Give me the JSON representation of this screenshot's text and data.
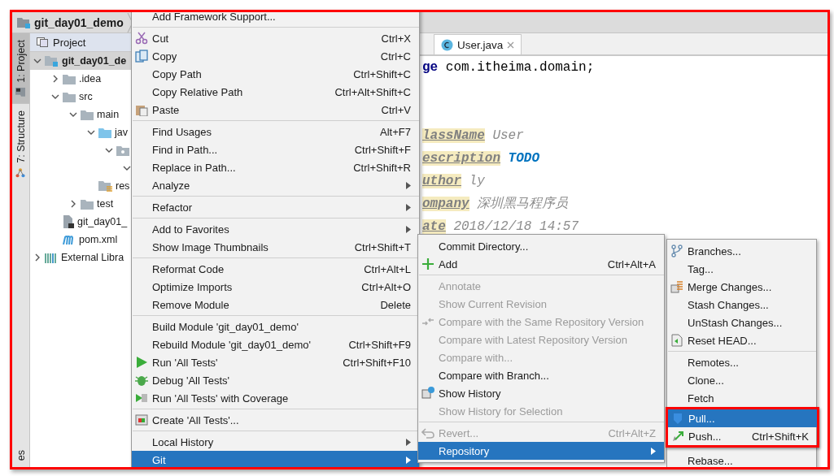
{
  "breadcrumb": {
    "label": "git_day01_demo"
  },
  "tool_strip": {
    "top": [
      {
        "label": "1: Project",
        "selected": true
      },
      {
        "label": "7: Structure",
        "selected": false
      }
    ],
    "bottom": [
      {
        "label": "es",
        "selected": false
      }
    ]
  },
  "project_panel": {
    "title": "Project",
    "tree": [
      {
        "label": "git_day01_de",
        "kind": "module",
        "expanded": true,
        "selected": true,
        "children": [
          {
            "label": ".idea",
            "kind": "folder",
            "expanded": false,
            "selected": false
          },
          {
            "label": "src",
            "kind": "folder",
            "expanded": true,
            "selected": false,
            "children": [
              {
                "label": "main",
                "kind": "folder",
                "expanded": true,
                "selected": false,
                "children": [
                  {
                    "label": "jav",
                    "kind": "source-folder",
                    "expanded": true,
                    "selected": false,
                    "children": [
                      {
                        "kind": "package",
                        "expanded": true,
                        "selected": false,
                        "children": [
                          {
                            "expanded": true,
                            "selected": false
                          }
                        ]
                      }
                    ]
                  },
                  {
                    "label": "res",
                    "kind": "resource-folder",
                    "selected": false
                  }
                ]
              },
              {
                "label": "test",
                "kind": "folder",
                "expanded": false,
                "selected": false
              }
            ]
          },
          {
            "label": "git_day01_",
            "kind": "module-file",
            "selected": false
          },
          {
            "label": "pom.xml",
            "kind": "maven-file",
            "selected": false
          }
        ]
      },
      {
        "label": "External Libra",
        "kind": "library",
        "expanded": false,
        "selected": false
      }
    ]
  },
  "editor": {
    "tabs": [
      {
        "label": "User.java",
        "selected": true
      }
    ],
    "lines": [
      {
        "kind": "code",
        "segments": [
          {
            "text": "ge",
            "kind": "keyword"
          },
          {
            "text": " com.itheima.domain;",
            "kind": "plain"
          }
        ]
      },
      {
        "kind": "blank"
      },
      {
        "kind": "blank"
      },
      {
        "kind": "code",
        "segments": [
          {
            "text": "lassName",
            "kind": "tag"
          },
          {
            "text": " User",
            "kind": "value"
          }
        ]
      },
      {
        "kind": "code",
        "segments": [
          {
            "text": "escription",
            "kind": "tag"
          },
          {
            "text": " TODO",
            "kind": "todo"
          }
        ]
      },
      {
        "kind": "code",
        "segments": [
          {
            "text": "uthor",
            "kind": "tag"
          },
          {
            "text": " ly",
            "kind": "value"
          }
        ]
      },
      {
        "kind": "code",
        "segments": [
          {
            "text": "ompany",
            "kind": "tag"
          },
          {
            "text": " 深圳黑马程序员",
            "kind": "value"
          }
        ]
      },
      {
        "kind": "code",
        "segments": [
          {
            "text": "ate",
            "kind": "tag"
          },
          {
            "text": " 2018/12/18 14:57",
            "kind": "value"
          }
        ]
      }
    ]
  },
  "menus": [
    {
      "items": [
        {
          "kind": "item",
          "label": "Add Framework Support...",
          "submenu": false,
          "disabled": false,
          "selected": false
        },
        {
          "kind": "separator"
        },
        {
          "kind": "item",
          "label": "Cut",
          "shortcut": "Ctrl+X",
          "submenu": false,
          "disabled": false,
          "selected": false
        },
        {
          "kind": "item",
          "label": "Copy",
          "shortcut": "Ctrl+C",
          "submenu": false,
          "disabled": false,
          "selected": false
        },
        {
          "kind": "item",
          "label": "Copy Path",
          "shortcut": "Ctrl+Shift+C",
          "submenu": false,
          "disabled": false,
          "selected": false
        },
        {
          "kind": "item",
          "label": "Copy Relative Path",
          "shortcut": "Ctrl+Alt+Shift+C",
          "submenu": false,
          "disabled": false,
          "selected": false
        },
        {
          "kind": "item",
          "label": "Paste",
          "shortcut": "Ctrl+V",
          "submenu": false,
          "disabled": false,
          "selected": false
        },
        {
          "kind": "separator"
        },
        {
          "kind": "item",
          "label": "Find Usages",
          "shortcut": "Alt+F7",
          "submenu": false,
          "disabled": false,
          "selected": false
        },
        {
          "kind": "item",
          "label": "Find in Path...",
          "shortcut": "Ctrl+Shift+F",
          "submenu": false,
          "disabled": false,
          "selected": false
        },
        {
          "kind": "item",
          "label": "Replace in Path...",
          "shortcut": "Ctrl+Shift+R",
          "submenu": false,
          "disabled": false,
          "selected": false
        },
        {
          "kind": "item",
          "label": "Analyze",
          "submenu": true,
          "disabled": false,
          "selected": false
        },
        {
          "kind": "separator"
        },
        {
          "kind": "item",
          "label": "Refactor",
          "submenu": true,
          "disabled": false,
          "selected": false
        },
        {
          "kind": "separator"
        },
        {
          "kind": "item",
          "label": "Add to Favorites",
          "submenu": true,
          "disabled": false,
          "selected": false
        },
        {
          "kind": "item",
          "label": "Show Image Thumbnails",
          "shortcut": "Ctrl+Shift+T",
          "submenu": false,
          "disabled": false,
          "selected": false
        },
        {
          "kind": "separator"
        },
        {
          "kind": "item",
          "label": "Reformat Code",
          "shortcut": "Ctrl+Alt+L",
          "submenu": false,
          "disabled": false,
          "selected": false
        },
        {
          "kind": "item",
          "label": "Optimize Imports",
          "shortcut": "Ctrl+Alt+O",
          "submenu": false,
          "disabled": false,
          "selected": false
        },
        {
          "kind": "item",
          "label": "Remove Module",
          "shortcut": "Delete",
          "submenu": false,
          "disabled": false,
          "selected": false
        },
        {
          "kind": "separator"
        },
        {
          "kind": "item",
          "label": "Build Module 'git_day01_demo'",
          "submenu": false,
          "disabled": false,
          "selected": false
        },
        {
          "kind": "item",
          "label": "Rebuild Module 'git_day01_demo'",
          "shortcut": "Ctrl+Shift+F9",
          "submenu": false,
          "disabled": false,
          "selected": false
        },
        {
          "kind": "item",
          "label": "Run 'All Tests'",
          "shortcut": "Ctrl+Shift+F10",
          "submenu": false,
          "disabled": false,
          "selected": false
        },
        {
          "kind": "item",
          "label": "Debug 'All Tests'",
          "submenu": false,
          "disabled": false,
          "selected": false
        },
        {
          "kind": "item",
          "label": "Run 'All Tests' with Coverage",
          "submenu": false,
          "disabled": false,
          "selected": false
        },
        {
          "kind": "separator"
        },
        {
          "kind": "item",
          "label": "Create 'All Tests'...",
          "submenu": false,
          "disabled": false,
          "selected": false
        },
        {
          "kind": "separator"
        },
        {
          "kind": "item",
          "label": "Local History",
          "submenu": true,
          "disabled": false,
          "selected": false
        },
        {
          "kind": "item",
          "label": "Git",
          "submenu": true,
          "disabled": false,
          "selected": true
        }
      ]
    },
    {
      "items": [
        {
          "kind": "item",
          "label": "Commit Directory...",
          "submenu": false,
          "disabled": false,
          "selected": false
        },
        {
          "kind": "item",
          "label": "Add",
          "shortcut": "Ctrl+Alt+A",
          "submenu": false,
          "disabled": false,
          "selected": false
        },
        {
          "kind": "separator"
        },
        {
          "kind": "item",
          "label": "Annotate",
          "submenu": false,
          "disabled": true,
          "selected": false
        },
        {
          "kind": "item",
          "label": "Show Current Revision",
          "submenu": false,
          "disabled": true,
          "selected": false
        },
        {
          "kind": "item",
          "label": "Compare with the Same Repository Version",
          "submenu": false,
          "disabled": true,
          "selected": false
        },
        {
          "kind": "item",
          "label": "Compare with Latest Repository Version",
          "submenu": false,
          "disabled": true,
          "selected": false
        },
        {
          "kind": "item",
          "label": "Compare with...",
          "submenu": false,
          "disabled": true,
          "selected": false
        },
        {
          "kind": "item",
          "label": "Compare with Branch...",
          "submenu": false,
          "disabled": false,
          "selected": false
        },
        {
          "kind": "item",
          "label": "Show History",
          "submenu": false,
          "disabled": false,
          "selected": false
        },
        {
          "kind": "item",
          "label": "Show History for Selection",
          "submenu": false,
          "disabled": true,
          "selected": false
        },
        {
          "kind": "separator"
        },
        {
          "kind": "item",
          "label": "Revert...",
          "shortcut": "Ctrl+Alt+Z",
          "submenu": false,
          "disabled": true,
          "selected": false
        },
        {
          "kind": "item",
          "label": "Repository",
          "submenu": true,
          "disabled": false,
          "selected": true
        }
      ]
    },
    {
      "items": [
        {
          "kind": "item",
          "label": "Branches...",
          "submenu": false,
          "disabled": false,
          "selected": false,
          "outlined": false
        },
        {
          "kind": "item",
          "label": "Tag...",
          "submenu": false,
          "disabled": false,
          "selected": false,
          "outlined": false
        },
        {
          "kind": "item",
          "label": "Merge Changes...",
          "submenu": false,
          "disabled": false,
          "selected": false,
          "outlined": false
        },
        {
          "kind": "item",
          "label": "Stash Changes...",
          "submenu": false,
          "disabled": false,
          "selected": false,
          "outlined": false
        },
        {
          "kind": "item",
          "label": "UnStash Changes...",
          "submenu": false,
          "disabled": false,
          "selected": false,
          "outlined": false
        },
        {
          "kind": "item",
          "label": "Reset HEAD...",
          "submenu": false,
          "disabled": false,
          "selected": false,
          "outlined": false
        },
        {
          "kind": "separator"
        },
        {
          "kind": "item",
          "label": "Remotes...",
          "submenu": false,
          "disabled": false,
          "selected": false,
          "outlined": false
        },
        {
          "kind": "item",
          "label": "Clone...",
          "submenu": false,
          "disabled": false,
          "selected": false,
          "outlined": false
        },
        {
          "kind": "item",
          "label": "Fetch",
          "submenu": false,
          "disabled": false,
          "selected": false,
          "outlined": false
        },
        {
          "kind": "item",
          "label": "Pull...",
          "submenu": false,
          "disabled": false,
          "selected": true,
          "outlined": true
        },
        {
          "kind": "item",
          "label": "Push...",
          "shortcut": "Ctrl+Shift+K",
          "submenu": false,
          "disabled": false,
          "selected": false,
          "outlined": true
        },
        {
          "kind": "separator"
        },
        {
          "kind": "item",
          "label": "Rebase...",
          "submenu": false,
          "disabled": false,
          "selected": false,
          "outlined": false
        }
      ]
    }
  ]
}
